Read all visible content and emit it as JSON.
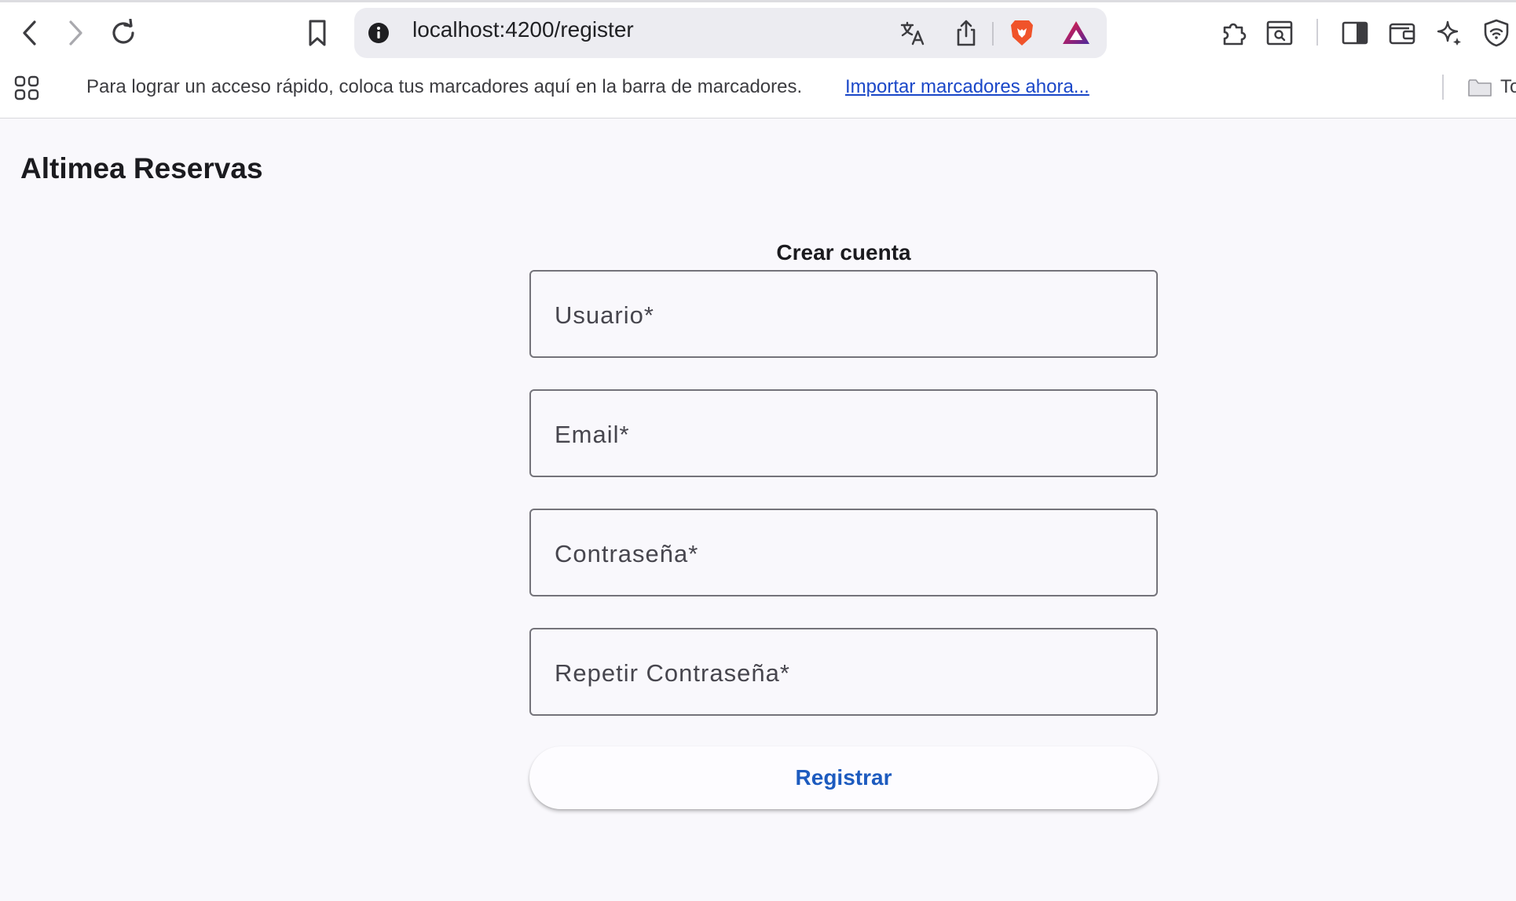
{
  "browser": {
    "url": "localhost:4200/register",
    "bookmarks_bar": {
      "hint": "Para lograr un acceso rápido, coloca tus marcadores aquí en la barra de marcadores.",
      "import_link": "Importar marcadores ahora...",
      "folder_label": "To"
    },
    "icons": {
      "back": "back-arrow-icon",
      "forward": "forward-arrow-icon",
      "reload": "reload-icon",
      "bookmark": "bookmark-icon",
      "site_info": "info-icon",
      "translate": "translate-icon",
      "share": "share-icon",
      "brave_shields": "brave-lion-icon",
      "brave_rewards": "rewards-triangle-icon",
      "extensions": "puzzle-icon",
      "search_tab": "search-window-icon",
      "sidebar": "sidebar-icon",
      "wallet": "wallet-icon",
      "leo_ai": "sparkle-icon",
      "vpn": "vpn-shield-icon",
      "apps": "apps-grid-icon",
      "folder": "folder-icon"
    }
  },
  "app": {
    "title": "Altimea Reservas"
  },
  "register_form": {
    "title": "Crear cuenta",
    "fields": [
      {
        "label": "Usuario*",
        "value": ""
      },
      {
        "label": "Email*",
        "value": ""
      },
      {
        "label": "Contraseña*",
        "value": ""
      },
      {
        "label": "Repetir Contraseña*",
        "value": ""
      }
    ],
    "submit_label": "Registrar"
  },
  "colors": {
    "page_background": "#f9f8fc",
    "field_border": "#74737a",
    "button_text": "#1d5bbf",
    "link": "#1a47c8"
  }
}
